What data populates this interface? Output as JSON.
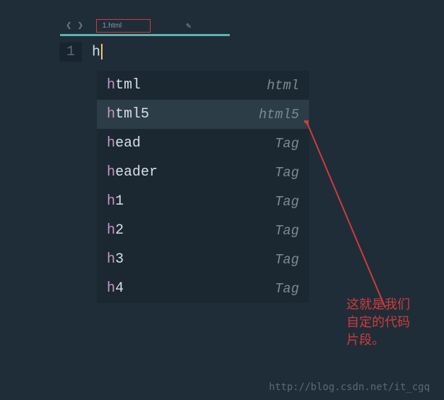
{
  "tab": {
    "filename": "1.html"
  },
  "editor": {
    "line_number": "1",
    "typed": "h"
  },
  "autocomplete": {
    "items": [
      {
        "match": "h",
        "rest": "tml",
        "type": "html",
        "selected": false
      },
      {
        "match": "h",
        "rest": "tml5",
        "type": "html5",
        "selected": true
      },
      {
        "match": "h",
        "rest": "ead",
        "type": "Tag",
        "selected": false
      },
      {
        "match": "h",
        "rest": "eader",
        "type": "Tag",
        "selected": false
      },
      {
        "match": "h",
        "rest": "1",
        "type": "Tag",
        "selected": false
      },
      {
        "match": "h",
        "rest": "2",
        "type": "Tag",
        "selected": false
      },
      {
        "match": "h",
        "rest": "3",
        "type": "Tag",
        "selected": false
      },
      {
        "match": "h",
        "rest": "4",
        "type": "Tag",
        "selected": false
      }
    ]
  },
  "annotation": {
    "line1": "这就是我们",
    "line2": "自定的代码",
    "line3": "片段。"
  },
  "watermark": "http://blog.csdn.net/it_cgq"
}
